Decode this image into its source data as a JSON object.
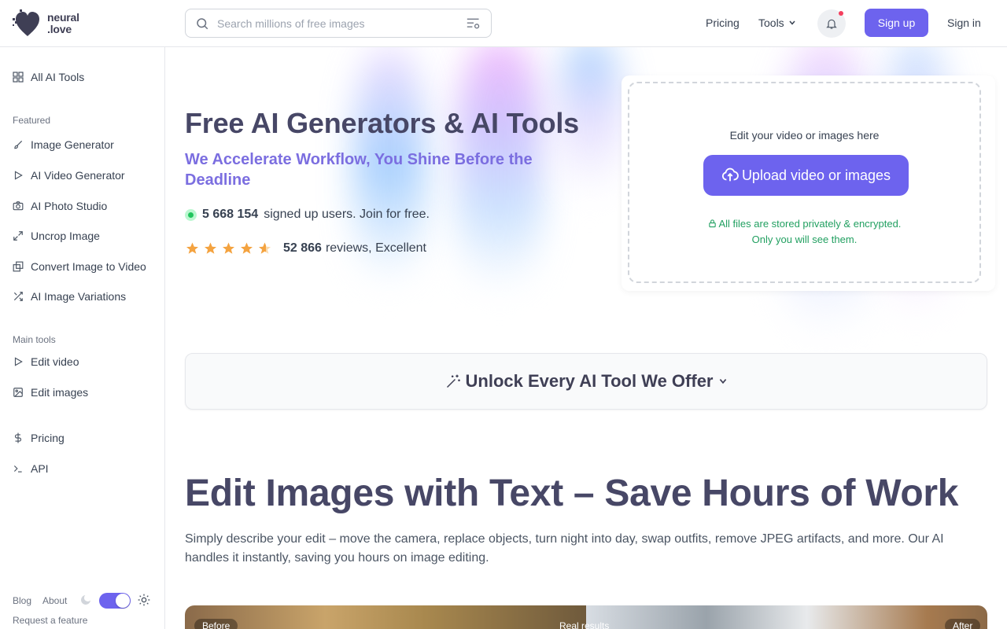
{
  "header": {
    "logo_line1": "neural",
    "logo_line2": ".love",
    "search_placeholder": "Search millions of free images",
    "nav": {
      "pricing": "Pricing",
      "tools": "Tools"
    },
    "signup": "Sign up",
    "signin": "Sign in"
  },
  "sidebar": {
    "all_tools": "All AI Tools",
    "featured_label": "Featured",
    "featured": [
      {
        "label": "Image Generator",
        "icon": "brush-icon"
      },
      {
        "label": "AI Video Generator",
        "icon": "play-icon"
      },
      {
        "label": "AI Photo Studio",
        "icon": "camera-icon"
      },
      {
        "label": "Uncrop Image",
        "icon": "expand-icon"
      },
      {
        "label": "Convert Image to Video",
        "icon": "gallery-icon"
      },
      {
        "label": "AI Image Variations",
        "icon": "shuffle-icon"
      }
    ],
    "main_label": "Main tools",
    "main": [
      {
        "label": "Edit video",
        "icon": "play-icon"
      },
      {
        "label": "Edit images",
        "icon": "image-icon"
      }
    ],
    "pricing": "Pricing",
    "api": "API",
    "footer": {
      "blog": "Blog",
      "about": "About",
      "request": "Request a feature"
    },
    "theme_toggle_on": true
  },
  "hero": {
    "title": "Free AI Generators & AI Tools",
    "subtitle": "We Accelerate Workflow, You Shine Before the Deadline",
    "users_count": "5 668 154",
    "users_text": "signed up users. Join for free.",
    "rating_stars": 4.5,
    "reviews_count": "52 866",
    "reviews_text": "reviews, Excellent"
  },
  "upload": {
    "caption": "Edit your video or images here",
    "button": "Upload video or images",
    "privacy_line1": "All files are stored privately & encrypted.",
    "privacy_line2": "Only you will see them."
  },
  "unlock": {
    "label": "Unlock Every AI Tool We Offer"
  },
  "section": {
    "title": "Edit Images with Text – Save Hours of Work",
    "text": "Simply describe your edit – move the camera, replace objects, turn night into day, swap outfits, remove JPEG artifacts, and more. Our AI handles it instantly, saving you hours on image editing."
  },
  "compare": {
    "before": "Before",
    "middle": "Real results",
    "after": "After"
  },
  "colors": {
    "accent": "#6d63ee",
    "subtitle": "#7b6ee0",
    "title": "#474766",
    "success": "#22a061",
    "notify": "#f43f5e"
  }
}
